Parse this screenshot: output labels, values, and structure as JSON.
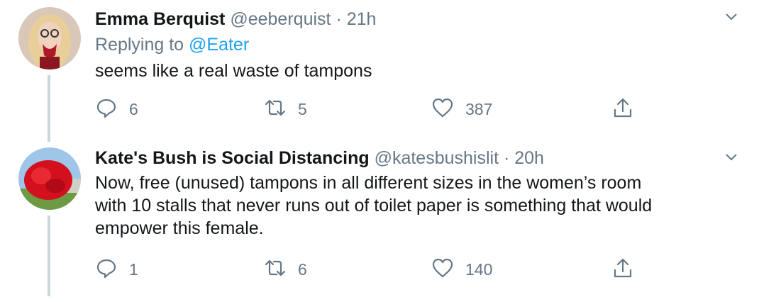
{
  "tweets": [
    {
      "name": "Emma Berquist",
      "handle": "@eeberquist",
      "separator": "·",
      "time": "21h",
      "replying_prefix": "Replying to",
      "replying_to": "@Eater",
      "text": "seems like a real waste of tampons",
      "replies": "6",
      "retweets": "5",
      "likes": "387"
    },
    {
      "name": "Kate's Bush is Social Distancing",
      "handle": "@katesbushislit",
      "separator": "·",
      "time": "20h",
      "text_lines": [
        "Now, free (unused) tampons in all different sizes in the women’s room",
        "with 10 stalls that never runs out of toilet paper is something that would",
        "empower this female."
      ],
      "replies": "1",
      "retweets": "6",
      "likes": "140"
    }
  ],
  "icons": [
    "reply-icon",
    "retweet-icon",
    "like-icon",
    "share-icon",
    "chevron-down-icon"
  ],
  "colors": {
    "muted": "#657786",
    "link": "#1da1f2",
    "line": "#ccd6dd",
    "text": "#14171a"
  }
}
